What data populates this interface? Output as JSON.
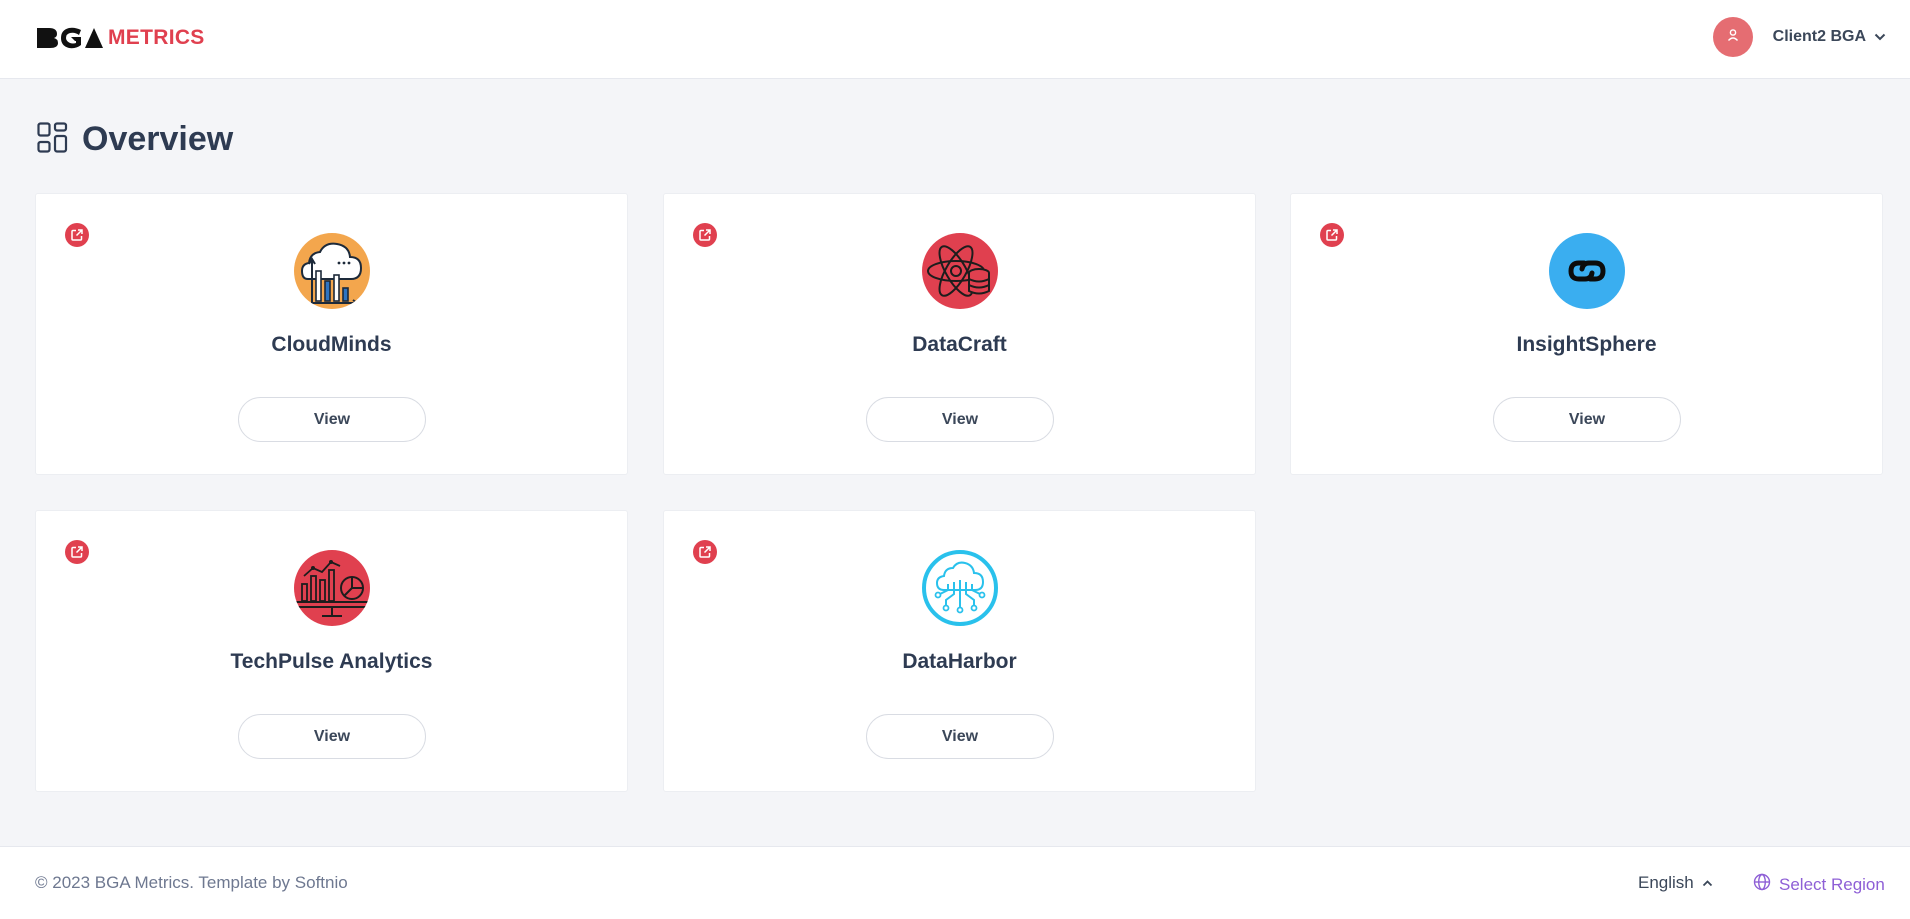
{
  "header": {
    "logo_text": "METRICS",
    "user_name": "Client2 BGA"
  },
  "page": {
    "title": "Overview"
  },
  "cards": [
    {
      "title": "CloudMinds",
      "button": "View",
      "icon": "cloud-chart-icon"
    },
    {
      "title": "DataCraft",
      "button": "View",
      "icon": "atom-database-icon"
    },
    {
      "title": "InsightSphere",
      "button": "View",
      "icon": "link-icon"
    },
    {
      "title": "TechPulse Analytics",
      "button": "View",
      "icon": "analytics-monitor-icon"
    },
    {
      "title": "DataHarbor",
      "button": "View",
      "icon": "cloud-network-icon"
    }
  ],
  "footer": {
    "copyright": "© 2023 BGA Metrics. Template by Softnio",
    "language": "English",
    "region": "Select Region"
  },
  "colors": {
    "accent": "#e0404f",
    "background": "#f4f5f8",
    "region_link": "#8e5fd6"
  }
}
